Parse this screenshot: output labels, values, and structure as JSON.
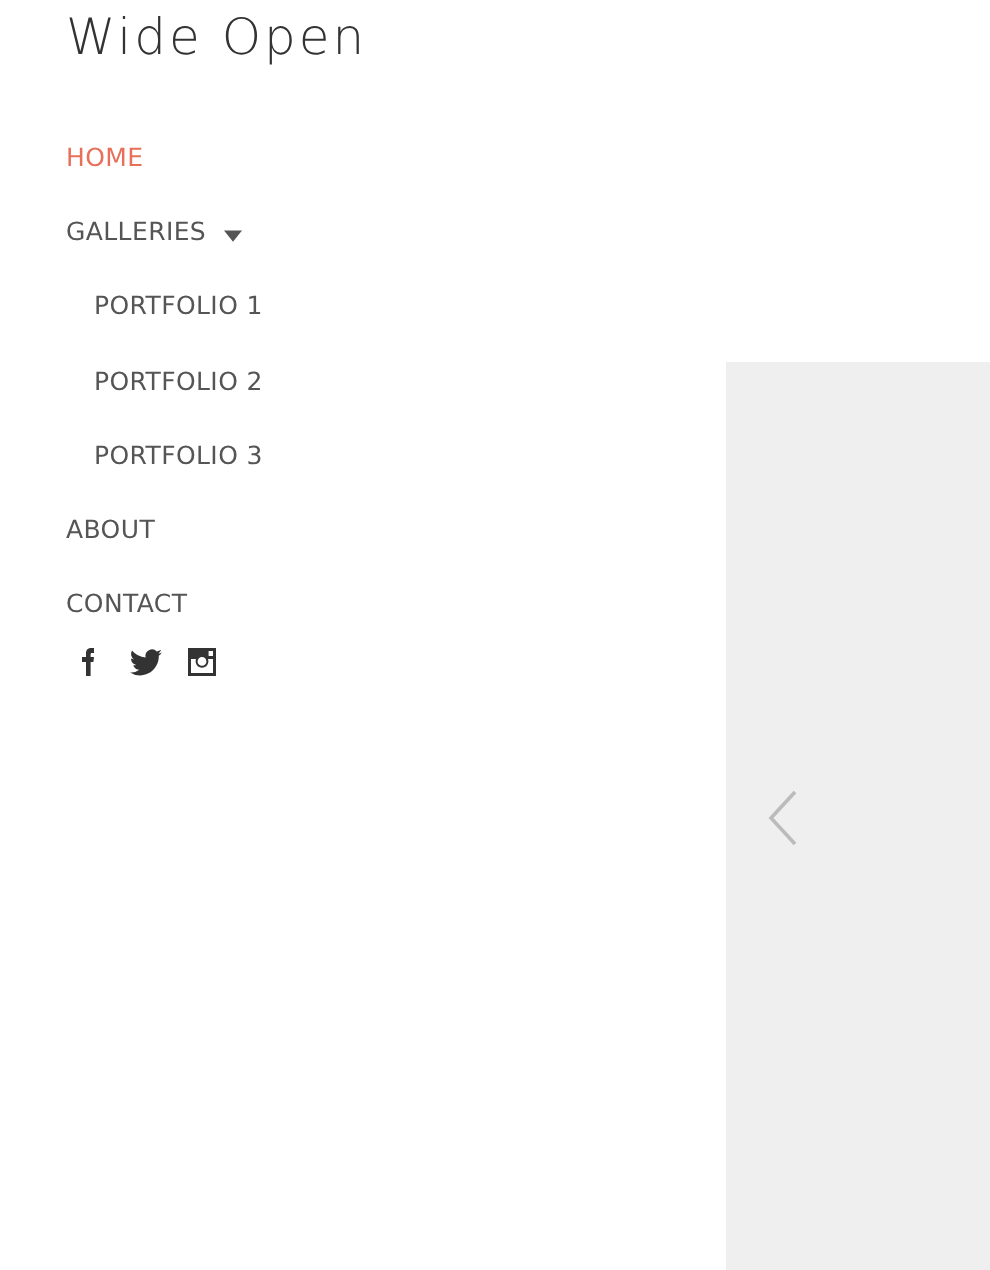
{
  "site_title": "Wide Open",
  "nav": [
    {
      "label": "HOME",
      "selected": true
    },
    {
      "label": "GALLERIES",
      "selected": false,
      "expanded": true,
      "children": [
        {
          "label": "PORTFOLIO 1",
          "selected": false
        },
        {
          "label": "PORTFOLIO 2",
          "selected": false
        },
        {
          "label": "PORTFOLIO 3",
          "selected": false
        }
      ]
    },
    {
      "label": "ABOUT",
      "selected": false
    },
    {
      "label": "CONTACT",
      "selected": false
    }
  ],
  "social": [
    {
      "kind": "facebook"
    },
    {
      "kind": "twitter"
    },
    {
      "kind": "instagram"
    }
  ],
  "slideshow": {
    "kind": "picture-area"
  }
}
